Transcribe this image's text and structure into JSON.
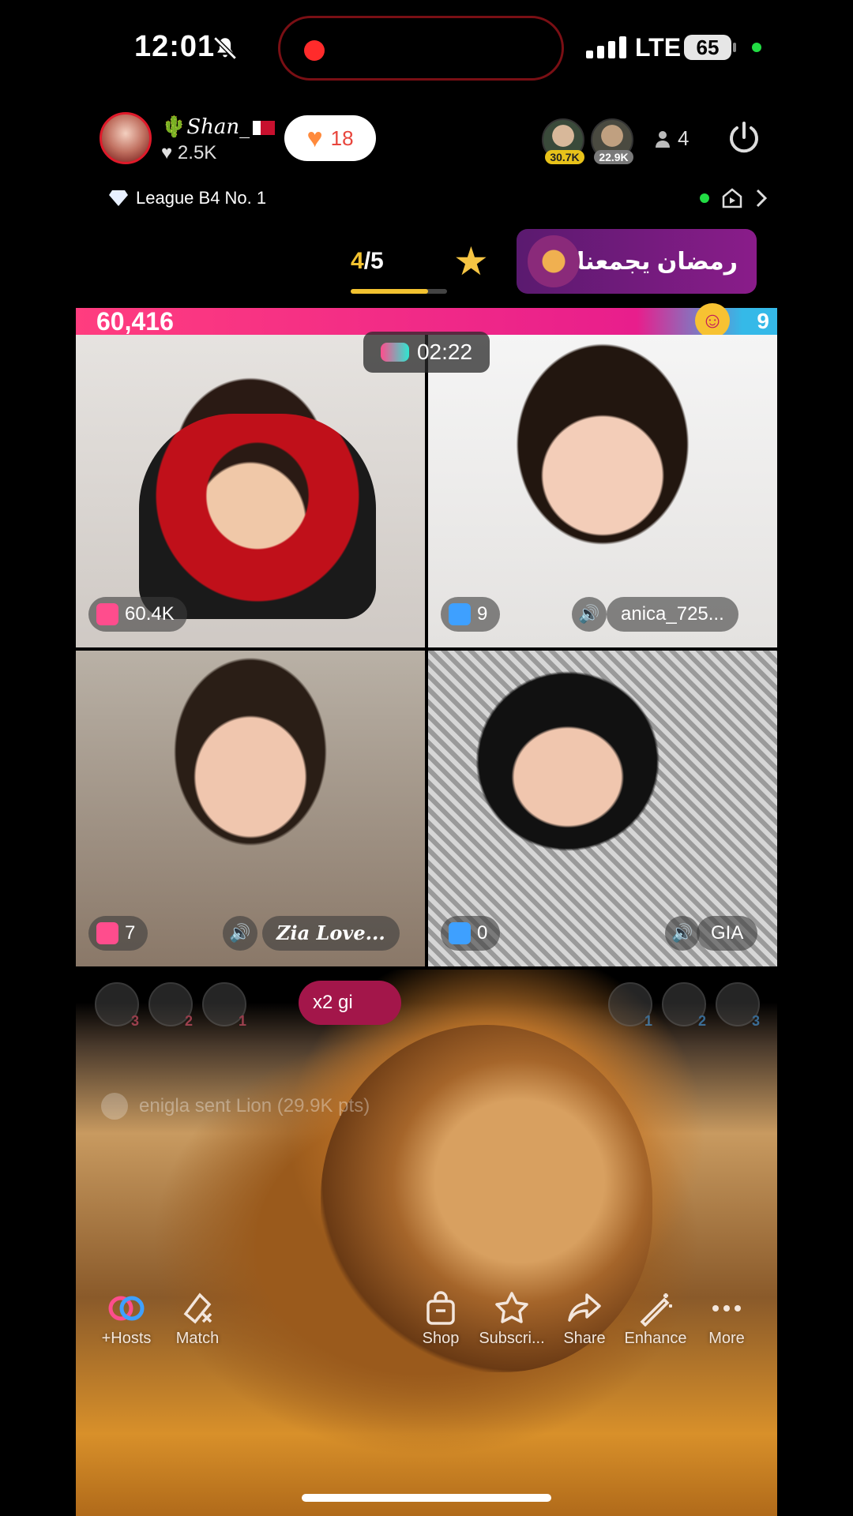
{
  "status_bar": {
    "time": "12:01",
    "network": "LTE",
    "battery": "65",
    "accent_record": "#ff2b2b",
    "icons": [
      "silent-bell-icon",
      "signal-icon",
      "battery-icon"
    ]
  },
  "host": {
    "name": "Shan_",
    "likes": "2.5K",
    "like_pill_count": "18"
  },
  "viewers": {
    "top1_score": "30.7K",
    "top2_score": "22.9K",
    "count": "4"
  },
  "league": "League B4 No. 1",
  "tabs": {
    "page_current": "4",
    "page_separator": "/",
    "page_total": "5",
    "page_progress": 0.8,
    "banner_text": "رمضان يجمعنا"
  },
  "battle": {
    "left_score": "60,416",
    "right_score": "9",
    "timer": "02:22"
  },
  "tiles": [
    {
      "gift": "60.4K",
      "name": ""
    },
    {
      "gift": "9",
      "name": "anica_725..."
    },
    {
      "gift": "7",
      "name": "Zia Love..."
    },
    {
      "gift": "0",
      "name": "GIA"
    }
  ],
  "ranks_left": [
    "3",
    "2",
    "1"
  ],
  "ranks_right": [
    "1",
    "2",
    "3"
  ],
  "gift_pill": "x2 gi",
  "sent_message": "enigla sent Lion (29.9K pts)",
  "toolbar": {
    "hosts": "+Hosts",
    "match": "Match",
    "shop": "Shop",
    "subscribe": "Subscri...",
    "share": "Share",
    "enhance": "Enhance",
    "more": "More"
  },
  "colors": {
    "score_pink": "#e81e8c",
    "score_blue": "#35b9e8",
    "gold": "#f2c230",
    "banner_purple": "#8a1c8a"
  }
}
